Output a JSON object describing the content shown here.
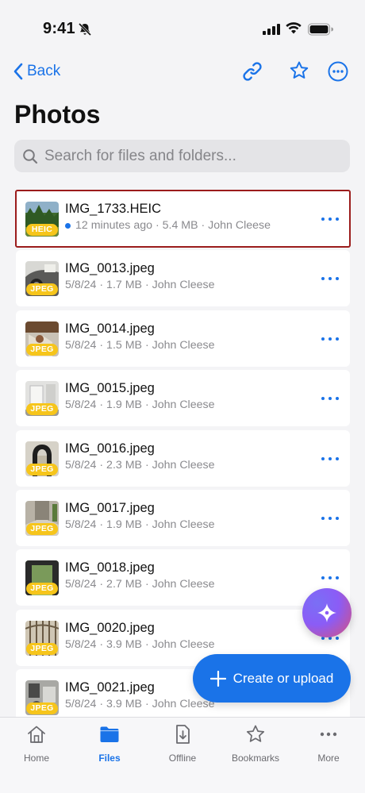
{
  "status_bar": {
    "time": "9:41"
  },
  "nav": {
    "back_label": "Back"
  },
  "page_title": "Photos",
  "search": {
    "placeholder": "Search for files and folders..."
  },
  "files": [
    {
      "name": "IMG_1733.HEIC",
      "meta": "12 minutes ago · 5.4 MB · John Cleese",
      "badge": "HEIC",
      "syncing": true,
      "selected": true
    },
    {
      "name": "IMG_0013.jpeg",
      "meta": "5/8/24 · 1.7 MB · John Cleese",
      "badge": "JPEG"
    },
    {
      "name": "IMG_0014.jpeg",
      "meta": "5/8/24 · 1.5 MB · John Cleese",
      "badge": "JPEG"
    },
    {
      "name": "IMG_0015.jpeg",
      "meta": "5/8/24 · 1.9 MB · John Cleese",
      "badge": "JPEG"
    },
    {
      "name": "IMG_0016.jpeg",
      "meta": "5/8/24 · 2.3 MB · John Cleese",
      "badge": "JPEG"
    },
    {
      "name": "IMG_0017.jpeg",
      "meta": "5/8/24 · 1.9 MB · John Cleese",
      "badge": "JPEG"
    },
    {
      "name": "IMG_0018.jpeg",
      "meta": "5/8/24 · 2.7 MB · John Cleese",
      "badge": "JPEG"
    },
    {
      "name": "IMG_0020.jpeg",
      "meta": "5/8/24 · 3.9 MB · John Cleese",
      "badge": "JPEG"
    },
    {
      "name": "IMG_0021.jpeg",
      "meta": "5/8/24 · 3.9 MB · John Cleese",
      "badge": "JPEG"
    }
  ],
  "create_button": {
    "label": "Create or upload"
  },
  "tabs": [
    {
      "label": "Home",
      "icon": "home-icon"
    },
    {
      "label": "Files",
      "icon": "folder-icon",
      "active": true
    },
    {
      "label": "Offline",
      "icon": "offline-icon"
    },
    {
      "label": "Bookmarks",
      "icon": "star-icon"
    },
    {
      "label": "More",
      "icon": "more-icon"
    }
  ],
  "colors": {
    "accent": "#1a73e8",
    "badge": "#f6c51b",
    "selection": "#9b1c1c"
  }
}
